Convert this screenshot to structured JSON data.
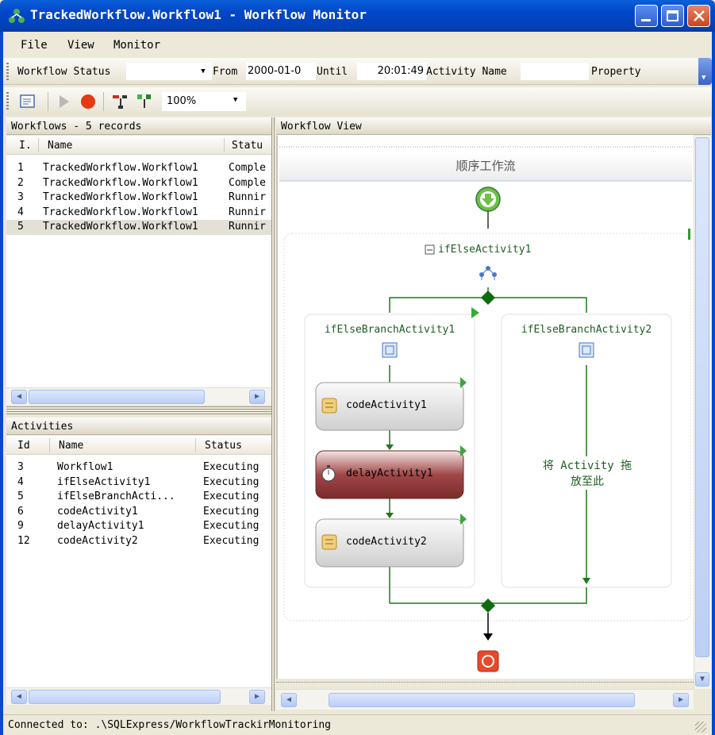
{
  "window": {
    "title": "TrackedWorkflow.Workflow1 - Workflow Monitor"
  },
  "menu": {
    "items": [
      "File",
      "View",
      "Monitor"
    ]
  },
  "filter_toolbar": {
    "workflow_status_label": "Workflow Status",
    "workflow_status_value": "",
    "from_label": "From",
    "from_value": "2000-01-0",
    "until_label": "Until",
    "until_value": "20:01:49",
    "activity_name_label": "Activity Name",
    "activity_name_value": "",
    "property_label": "Property"
  },
  "action_toolbar": {
    "zoom_value": "100%",
    "icons": [
      "monitor-settings-icon",
      "play-icon",
      "stop-icon",
      "expand-icon",
      "collapse-icon"
    ]
  },
  "workflows_panel": {
    "header": "Workflows - 5 records",
    "columns": [
      "I.",
      "Name",
      "Statu"
    ],
    "rows": [
      {
        "id": "1",
        "name": "TrackedWorkflow.Workflow1",
        "status": "Comple"
      },
      {
        "id": "2",
        "name": "TrackedWorkflow.Workflow1",
        "status": "Comple"
      },
      {
        "id": "3",
        "name": "TrackedWorkflow.Workflow1",
        "status": "Runnir"
      },
      {
        "id": "4",
        "name": "TrackedWorkflow.Workflow1",
        "status": "Runnir"
      },
      {
        "id": "5",
        "name": "TrackedWorkflow.Workflow1",
        "status": "Runnir"
      }
    ],
    "selected_index": 4
  },
  "activities_panel": {
    "header": "Activities",
    "columns": [
      "Id",
      "Name",
      "Status"
    ],
    "rows": [
      {
        "id": "3",
        "name": "Workflow1",
        "status": "Executing"
      },
      {
        "id": "4",
        "name": "ifElseActivity1",
        "status": "Executing"
      },
      {
        "id": "5",
        "name": "ifElseBranchActi...",
        "status": "Executing"
      },
      {
        "id": "6",
        "name": "codeActivity1",
        "status": "Executing"
      },
      {
        "id": "9",
        "name": "delayActivity1",
        "status": "Executing"
      },
      {
        "id": "12",
        "name": "codeActivity2",
        "status": "Executing"
      }
    ]
  },
  "workflow_view": {
    "header": "Workflow View",
    "sequential_title": "顺序工作流",
    "if_else_name": "ifElseActivity1",
    "branch1_name": "ifElseBranchActivity1",
    "branch2_name": "ifElseBranchActivity2",
    "activities": [
      "codeActivity1",
      "delayActivity1",
      "codeActivity2"
    ],
    "drop_hint_line1": "将 Activity 拖",
    "drop_hint_line2": "放至此",
    "colors": {
      "connector": "#1b7a1b",
      "active_activity": "#8b3a3a",
      "activity_box": "#e6e6e6",
      "stop": "#e8492a"
    }
  },
  "status_bar": {
    "text": "Connected to: .\\SQLExpress/WorkflowTrackirMonitoring"
  }
}
